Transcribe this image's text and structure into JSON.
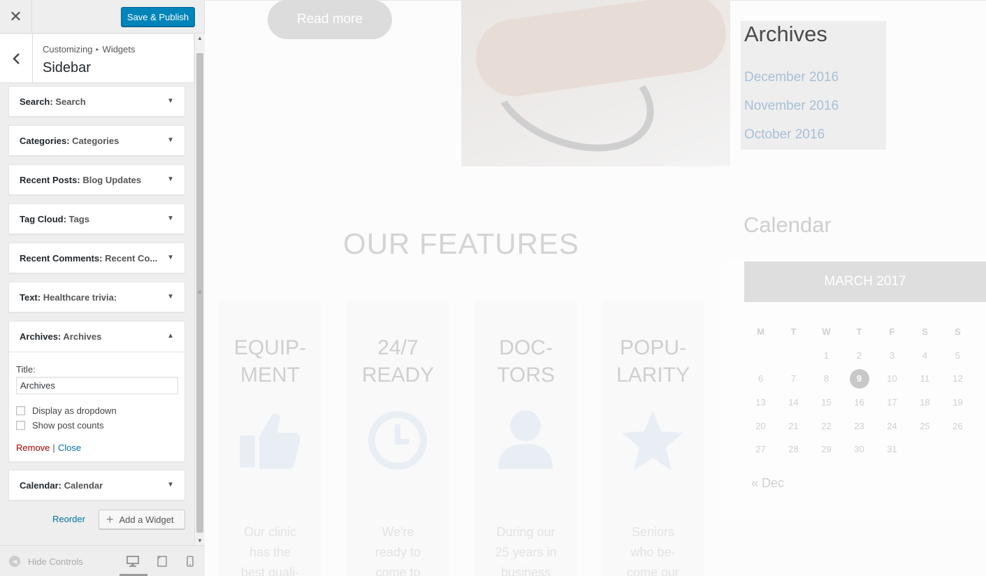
{
  "customizer": {
    "close_icon": "close-icon",
    "publish_label": "Save & Publish",
    "breadcrumb": {
      "root": "Customizing",
      "child": "Widgets"
    },
    "section_title": "Sidebar",
    "widgets": [
      {
        "type": "Search",
        "instance": "Search"
      },
      {
        "type": "Categories",
        "instance": "Categories"
      },
      {
        "type": "Recent Posts",
        "instance": "Blog Updates"
      },
      {
        "type": "Tag Cloud",
        "instance": "Tags"
      },
      {
        "type": "Recent Comments",
        "instance": "Recent Co..."
      },
      {
        "type": "Text",
        "instance": "Healthcare trivia:"
      },
      {
        "type": "Archives",
        "instance": "Archives"
      },
      {
        "type": "Calendar",
        "instance": "Calendar"
      }
    ],
    "archives_form": {
      "title_label": "Title:",
      "title_value": "Archives",
      "dropdown_label": "Display as dropdown",
      "post_counts_label": "Show post counts",
      "remove_label": "Remove",
      "separator": "|",
      "close_label": "Close"
    },
    "reorder_label": "Reorder",
    "add_widget_label": "Add a Widget",
    "hide_controls_label": "Hide Controls",
    "accent_color": "#0085ba"
  },
  "preview": {
    "read_more_label": "Read more",
    "archives": {
      "heading": "Archives",
      "links": [
        "December 2016",
        "November 2016",
        "October 2016"
      ]
    },
    "calendar": {
      "heading": "Calendar",
      "month": "MARCH 2017",
      "weekdays": [
        "M",
        "T",
        "W",
        "T",
        "F",
        "S",
        "S"
      ],
      "weeks": [
        [
          "",
          "",
          "1",
          "2",
          "3",
          "4",
          "5"
        ],
        [
          "6",
          "7",
          "8",
          "9",
          "10",
          "11",
          "12"
        ],
        [
          "13",
          "14",
          "15",
          "16",
          "17",
          "18",
          "19"
        ],
        [
          "20",
          "21",
          "22",
          "23",
          "24",
          "25",
          "26"
        ],
        [
          "27",
          "28",
          "29",
          "30",
          "31",
          "",
          ""
        ]
      ],
      "today": "9",
      "prev_link": "« Dec"
    },
    "features_heading": "OUR FEATURES",
    "features": [
      {
        "title_line1": "EQUIP-",
        "title_line2": "MENT",
        "icon": "thumbs-up-icon",
        "text_line1": "Our clinic",
        "text_line2": "has the",
        "text_line3": "best quali-"
      },
      {
        "title_line1": "24/7",
        "title_line2": "READY",
        "icon": "clock-icon",
        "text_line1": "We're",
        "text_line2": "ready to",
        "text_line3": "come to"
      },
      {
        "title_line1": "DOC-",
        "title_line2": "TORS",
        "icon": "user-icon",
        "text_line1": "During our",
        "text_line2": "25 years in",
        "text_line3": "business"
      },
      {
        "title_line1": "POPU-",
        "title_line2": "LARITY",
        "icon": "star-icon",
        "text_line1": "Seniors",
        "text_line2": "who be-",
        "text_line3": "come our"
      }
    ]
  }
}
